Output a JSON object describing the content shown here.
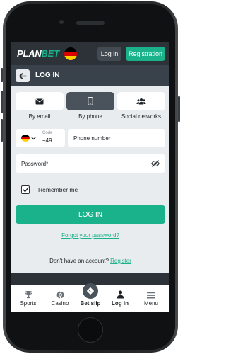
{
  "header": {
    "logo_plan": "PLAN",
    "logo_bet": "BET",
    "login_label": "Log in",
    "register_label": "Registration"
  },
  "page": {
    "title": "LOG IN"
  },
  "login_methods": [
    {
      "label": "By email",
      "icon": "envelope-icon",
      "active": false
    },
    {
      "label": "By phone",
      "icon": "smartphone-icon",
      "active": true
    },
    {
      "label": "Social networks",
      "icon": "users-icon",
      "active": false
    }
  ],
  "phone_form": {
    "code_label": "Code",
    "code_value": "+49",
    "phone_placeholder": "Phone number"
  },
  "password_form": {
    "placeholder": "Password*"
  },
  "remember": {
    "label": "Remember me",
    "checked": true
  },
  "submit_label": "LOG IN",
  "forgot_label": "Forgot your password?",
  "signup": {
    "prompt": "Don't have an account?",
    "link": "Register"
  },
  "bottom_nav": [
    {
      "label": "Sports",
      "icon": "trophy-icon"
    },
    {
      "label": "Casino",
      "icon": "poker-chip-icon"
    },
    {
      "label": "Bet slip",
      "icon": "ticket-icon"
    },
    {
      "label": "Log in",
      "icon": "person-icon"
    },
    {
      "label": "Menu",
      "icon": "hamburger-icon"
    }
  ],
  "colors": {
    "accent": "#19b28a",
    "topbar": "#2c3238",
    "headbar": "#39414a",
    "background": "#e9ecef"
  }
}
